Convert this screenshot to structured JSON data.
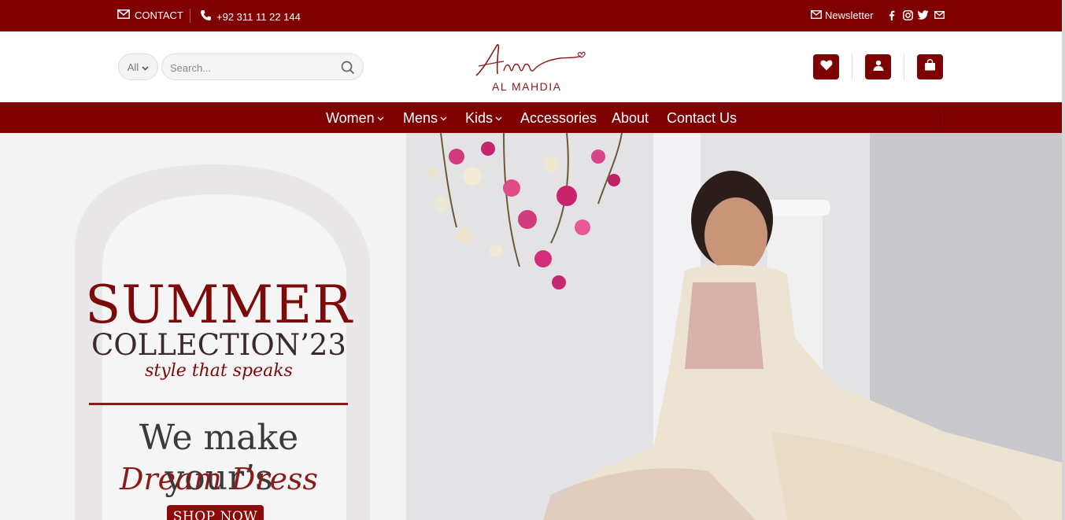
{
  "topbar": {
    "contact_label": "CONTACT",
    "phone": "+92 311 11 22 144",
    "newsletter_label": "Newsletter",
    "social_icons": [
      "facebook-icon",
      "instagram-icon",
      "twitter-icon",
      "email-icon"
    ]
  },
  "header": {
    "category_select": "All",
    "search_placeholder": "Search...",
    "logo_text": "AL MAHDIA",
    "icons": [
      "heart-icon",
      "user-icon",
      "shopping-bag-icon"
    ]
  },
  "nav": {
    "items": [
      {
        "label": "Women",
        "has_dropdown": true
      },
      {
        "label": "Mens",
        "has_dropdown": true
      },
      {
        "label": "Kids",
        "has_dropdown": true
      },
      {
        "label": "Accessories",
        "has_dropdown": false
      },
      {
        "label": "About",
        "has_dropdown": false
      },
      {
        "label": "Contact Us",
        "has_dropdown": false
      }
    ]
  },
  "hero": {
    "title": "SUMMER",
    "subtitle": "COLLECTION’23",
    "tagline": "style that speaks",
    "headline": "We make your’s",
    "headline_script": "Dream Dress",
    "cta_label": "SHOP NOW"
  },
  "colors": {
    "brand": "#7e0000",
    "accent": "#8b1a1a",
    "hero_bg": "#ebebed"
  }
}
